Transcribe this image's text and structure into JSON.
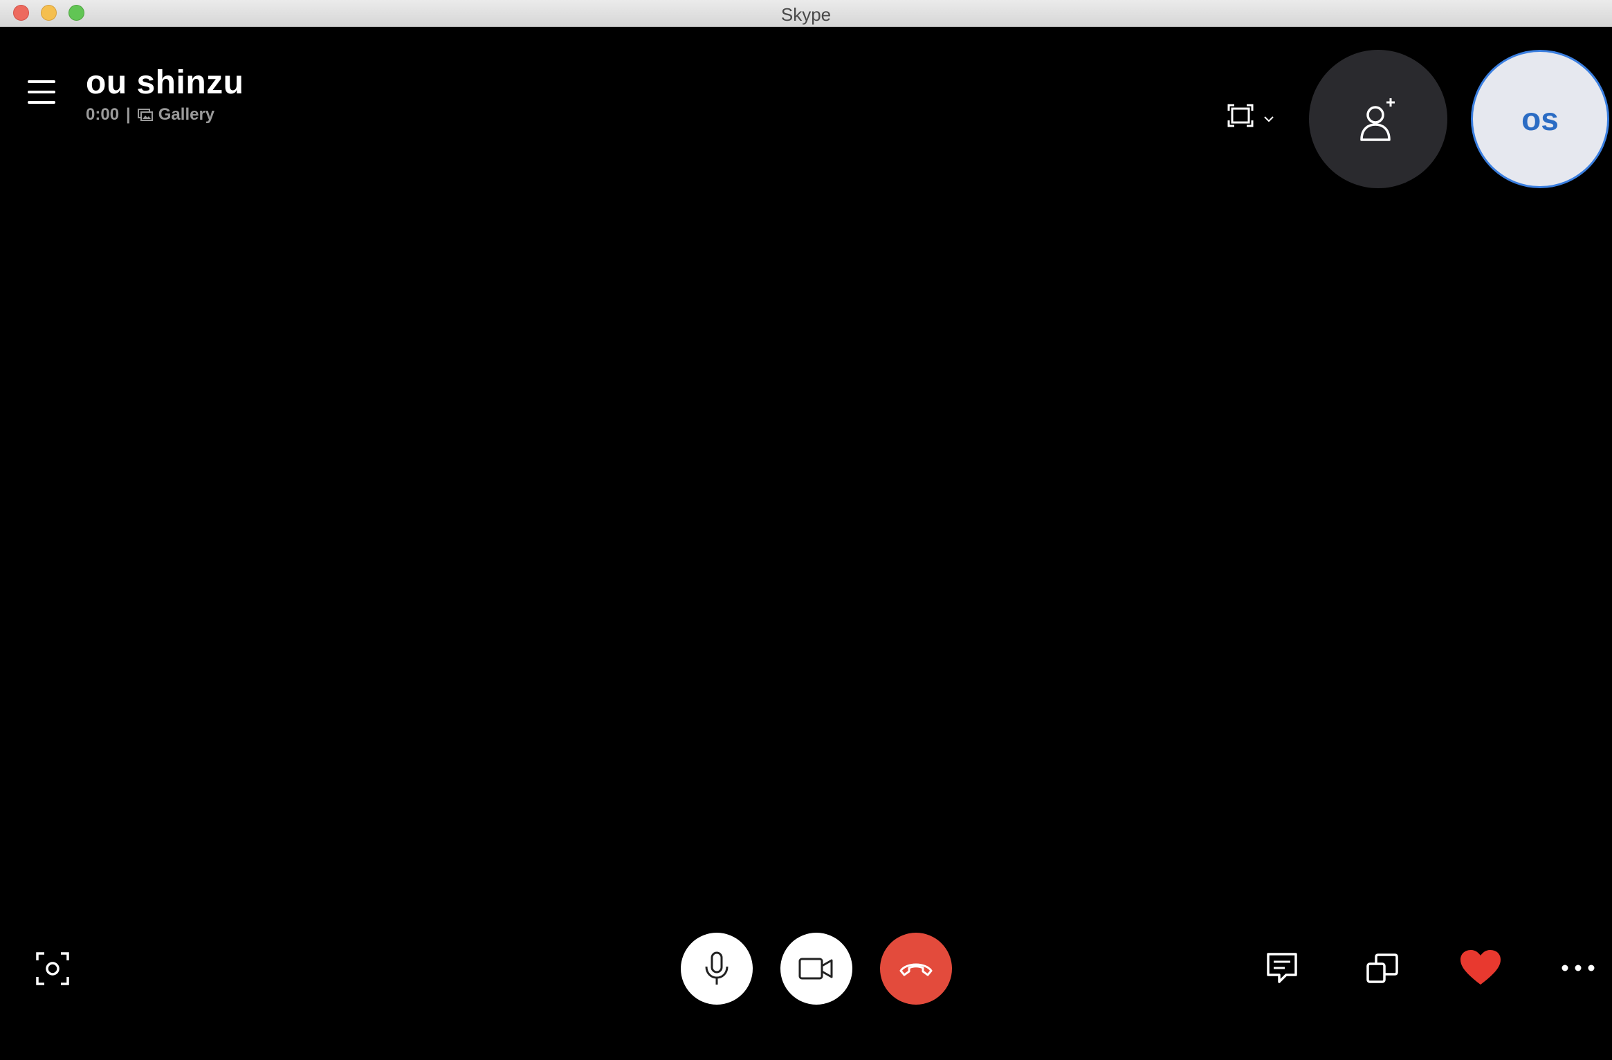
{
  "window": {
    "title": "Skype"
  },
  "call": {
    "contact_name": "ou shinzu",
    "timer": "0:00",
    "separator": "|",
    "view_mode": "Gallery"
  },
  "avatar": {
    "initials": "os"
  },
  "colors": {
    "background": "#000000",
    "end_call": "#e34b3c",
    "avatar_accent": "#3b7fe0",
    "heart": "#e8392f"
  },
  "icons": {
    "menu": "hamburger-menu-icon",
    "gallery": "gallery-icon",
    "view_switch": "screen-frame-icon",
    "add_people": "add-person-icon",
    "snapshot": "camera-snapshot-icon",
    "mic": "microphone-icon",
    "video": "video-camera-icon",
    "end_call": "hang-up-icon",
    "chat": "chat-icon",
    "share": "share-screen-icon",
    "reactions": "heart-icon",
    "more": "more-options-icon"
  }
}
